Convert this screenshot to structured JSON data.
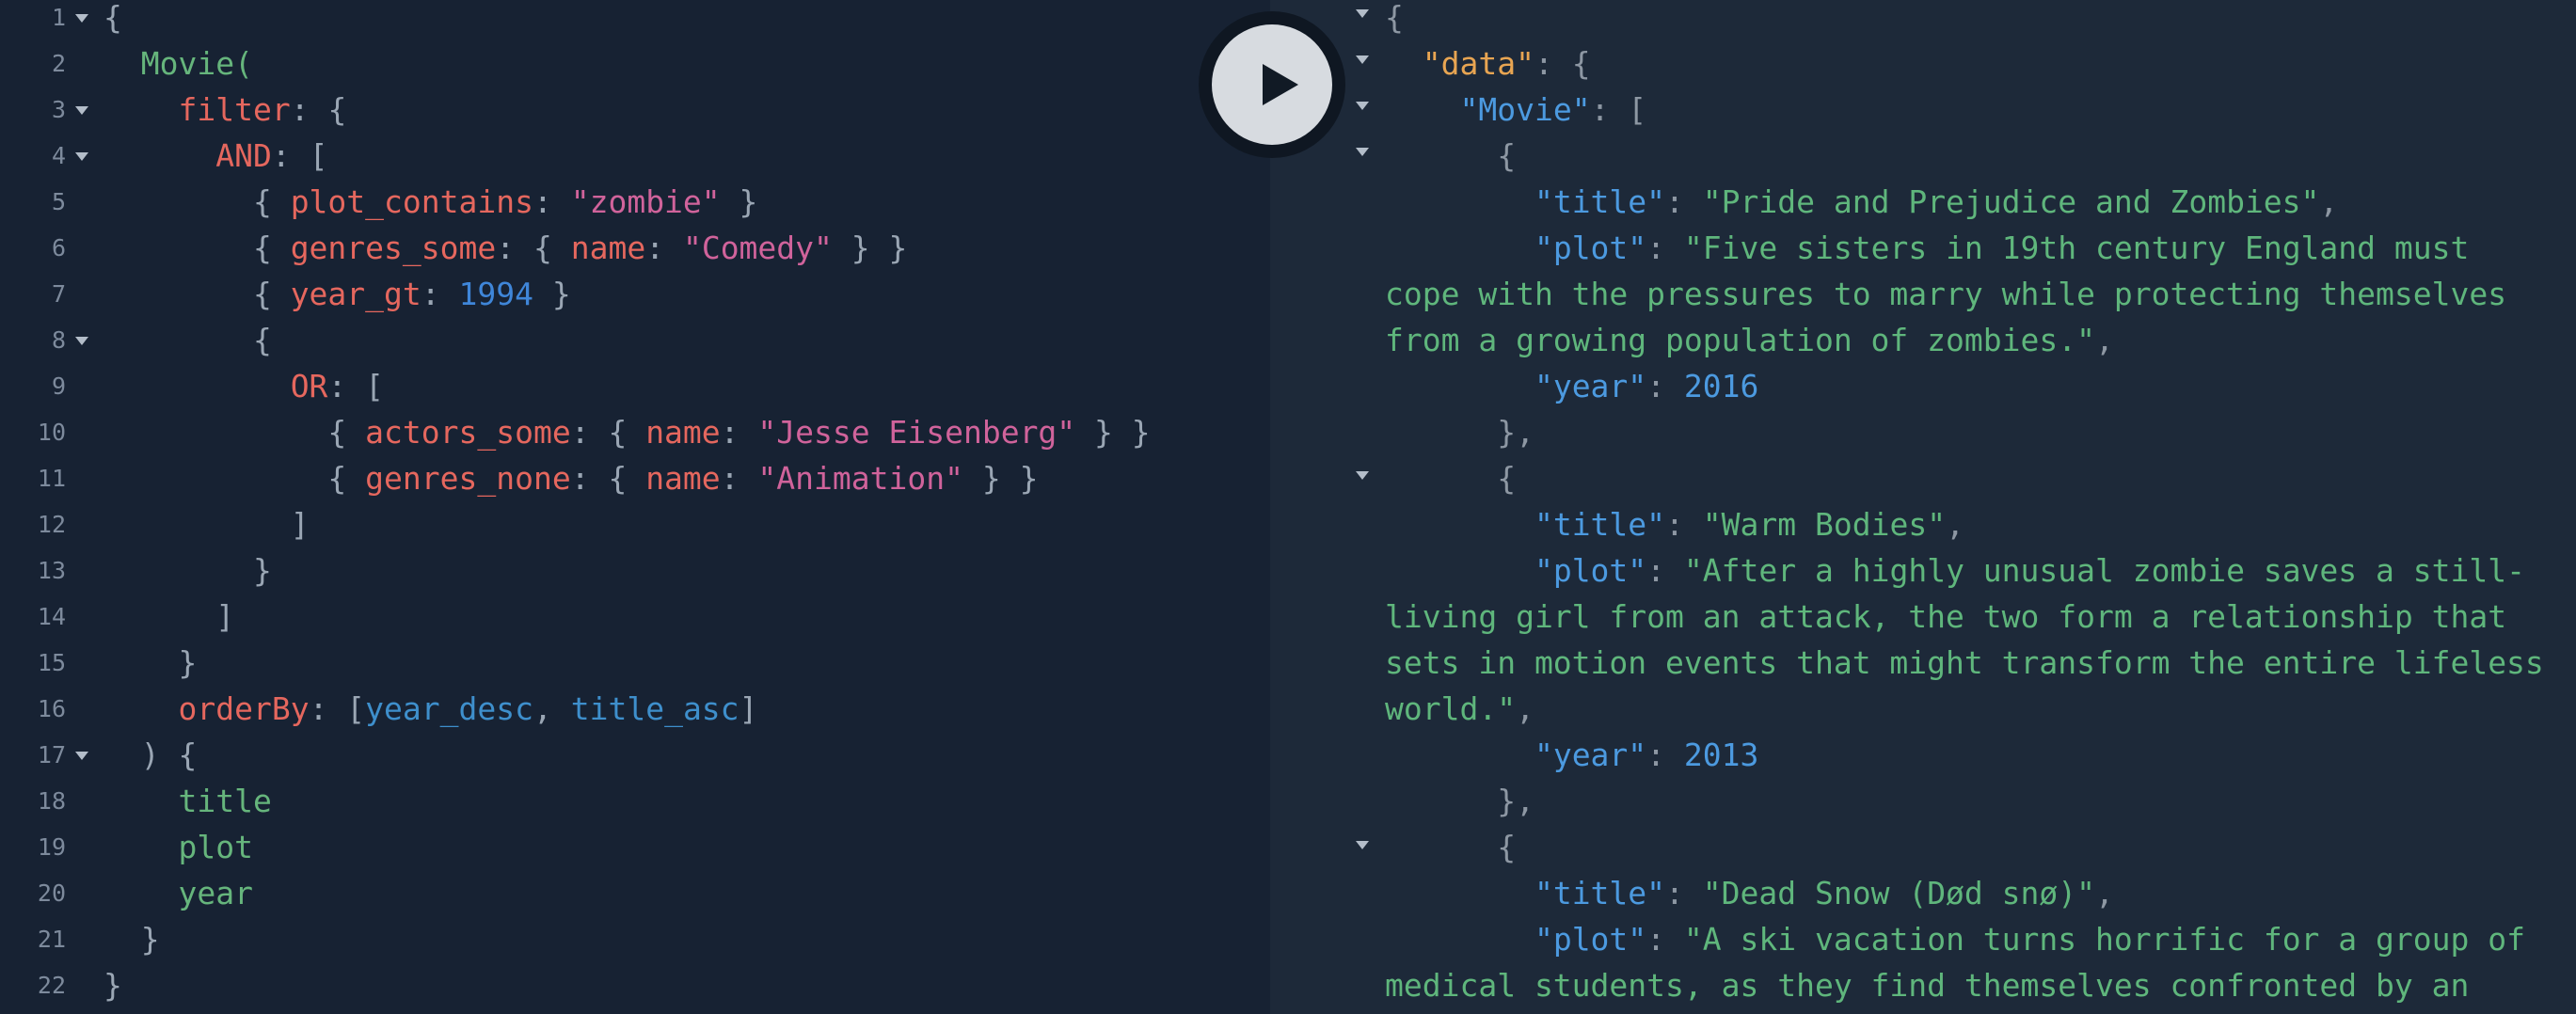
{
  "editor": {
    "line_numbers": [
      "1",
      "2",
      "3",
      "4",
      "5",
      "6",
      "7",
      "8",
      "9",
      "10",
      "11",
      "12",
      "13",
      "14",
      "15",
      "16",
      "17",
      "18",
      "19",
      "20",
      "21",
      "22"
    ],
    "q": {
      "brace_open": "{",
      "movie": "Movie",
      "paren_open": "(",
      "filter": "filter",
      "colon_brace": ": {",
      "and": "AND",
      "colon_bracket": ": [",
      "or": "OR",
      "plot_contains": "plot_contains",
      "zombie": "\"zombie\"",
      "genres_some": "genres_some",
      "name": "name",
      "comedy": "\"Comedy\"",
      "year_gt": "year_gt",
      "year_1994": "1994",
      "actors_some": "actors_some",
      "jesse": "\"Jesse Eisenberg\"",
      "genres_none": "genres_none",
      "animation": "\"Animation\"",
      "order_by": "orderBy",
      "year_desc": "year_desc",
      "title_asc": "title_asc",
      "bracket_close": "]",
      "brace_close": "}",
      "paren_close_brace": ") {",
      "f_title": "title",
      "f_plot": "plot",
      "f_year": "year"
    }
  },
  "results": {
    "k_data": "\"data\"",
    "k_movie": "\"Movie\"",
    "k_title": "\"title\"",
    "k_plot": "\"plot\"",
    "k_year": "\"year\"",
    "movies": [
      {
        "title": "\"Pride and Prejudice and Zombies\"",
        "plot_lines": [
          "\"Five sisters in 19th century England must",
          "cope with the pressures to marry while protecting themselves",
          "from a growing population of zombies.\""
        ],
        "year": "2016"
      },
      {
        "title": "\"Warm Bodies\"",
        "plot_lines": [
          "\"After a highly unusual zombie saves a still-",
          "living girl from an attack, the two form a relationship that",
          "sets in motion events that might transform the entire lifeless",
          "world.\""
        ],
        "year": "2013"
      },
      {
        "title": "\"Dead Snow (Død snø)\"",
        "plot_lines": [
          "\"A ski vacation turns horrific for a group of",
          "medical students, as they find themselves confronted by an"
        ]
      }
    ]
  },
  "toolbar": {
    "run_icon": "play-icon"
  }
}
